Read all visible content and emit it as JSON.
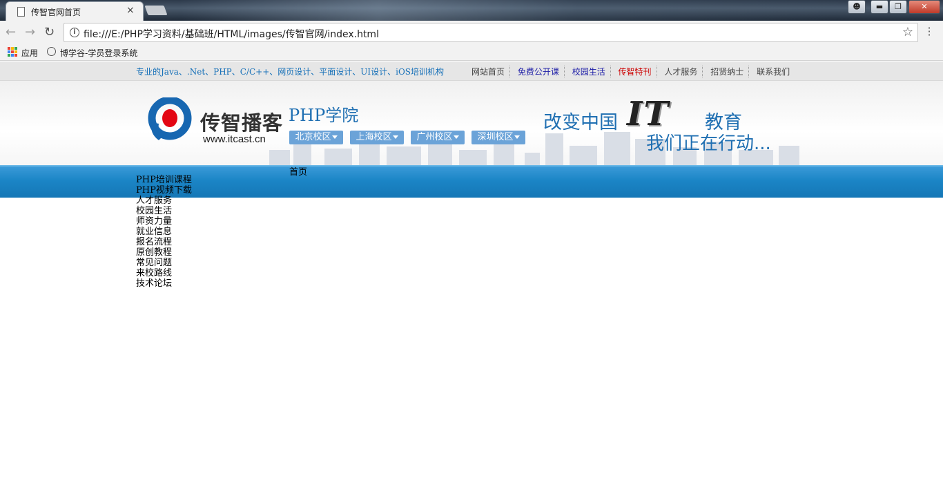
{
  "browser": {
    "tab_title": "传智官网首页",
    "tab_close": "×",
    "url": "file:///E:/PHP学习资料/基础班/HTML/images/传智官网/index.html",
    "bookmarks": [
      {
        "label": "应用"
      },
      {
        "label": "博学谷-学员登录系统"
      }
    ]
  },
  "topbar": {
    "tagline": "专业的Java、.Net、PHP、C/C++、网页设计、平面设计、UI设计、iOS培训机构",
    "links": [
      {
        "label": "网站首页",
        "color": "#444444"
      },
      {
        "label": "免费公开课",
        "color": "#1a1aa6"
      },
      {
        "label": "校园生活",
        "color": "#1a1aa6"
      },
      {
        "label": "传智特刊",
        "color": "#cc0000"
      },
      {
        "label": "人才服务",
        "color": "#444444"
      },
      {
        "label": "招贤纳士",
        "color": "#444444"
      },
      {
        "label": "联系我们",
        "color": "#444444"
      }
    ]
  },
  "header": {
    "logo_cn": "传智播客",
    "logo_en": "www.itcast.cn",
    "college": "PHP学院",
    "campuses": [
      "北京校区",
      "上海校区",
      "广州校区",
      "深圳校区"
    ],
    "slogan_line1_a": "改变中国",
    "slogan_it": "IT",
    "slogan_line1_b": "教育",
    "slogan_line2": "我们正在行动..."
  },
  "nav": {
    "home": "首页",
    "items": [
      "PHP培训课程",
      "PHP视频下载",
      "人才服务",
      "校园生活",
      "师资力量",
      "就业信息",
      "报名流程",
      "原创教程",
      "常见问题",
      "来校路线",
      "技术论坛"
    ]
  },
  "colors": {
    "accent_blue": "#1f6fb2",
    "nav_band": "#1b85c6",
    "campus_button": "#6ba3d8",
    "logo_red": "#e30613"
  }
}
